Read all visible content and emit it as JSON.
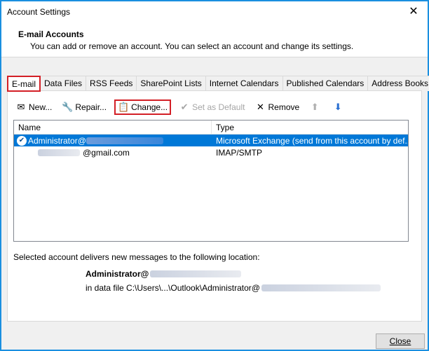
{
  "window": {
    "title": "Account Settings"
  },
  "header": {
    "title": "E-mail Accounts",
    "description": "You can add or remove an account. You can select an account and change its settings."
  },
  "tabs": [
    {
      "label": "E-mail",
      "active": true
    },
    {
      "label": "Data Files"
    },
    {
      "label": "RSS Feeds"
    },
    {
      "label": "SharePoint Lists"
    },
    {
      "label": "Internet Calendars"
    },
    {
      "label": "Published Calendars"
    },
    {
      "label": "Address Books"
    }
  ],
  "toolbar": {
    "new_label": "New...",
    "repair_label": "Repair...",
    "change_label": "Change...",
    "set_default_label": "Set as Default",
    "remove_label": "Remove"
  },
  "list": {
    "col_name": "Name",
    "col_type": "Type",
    "rows": [
      {
        "name": "Administrator@",
        "type": "Microsoft Exchange (send from this account by def...",
        "selected": true
      },
      {
        "name": "@gmail.com",
        "type": "IMAP/SMTP",
        "selected": false
      }
    ]
  },
  "info": {
    "text": "Selected account delivers new messages to the following location:",
    "location_name": "Administrator@",
    "location_file": "in data file C:\\Users\\...\\Outlook\\Administrator@"
  },
  "footer": {
    "close_label": "Close"
  },
  "colors": {
    "accent": "#0078d7",
    "highlight": "#d31f26",
    "border": "#1a8fe0"
  }
}
